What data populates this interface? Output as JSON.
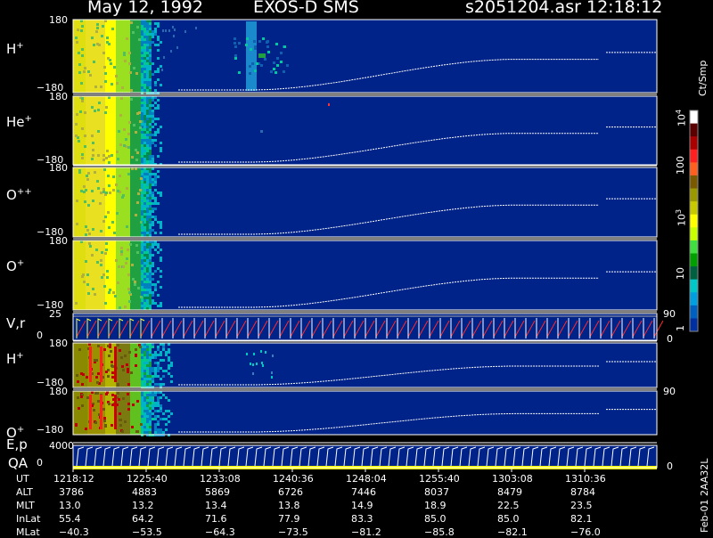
{
  "header": {
    "date": "May 12, 1992",
    "instrument": "EXOS-D SMS",
    "file": "s2051204.asr",
    "time": "12:18:12"
  },
  "panels": [
    {
      "name": "H",
      "sup": "+",
      "ymax": "180",
      "ymin": "−180"
    },
    {
      "name": "He",
      "sup": "+",
      "ymax": "180",
      "ymin": "−180"
    },
    {
      "name": "O",
      "sup": "++",
      "ymax": "180",
      "ymin": "−180"
    },
    {
      "name": "O",
      "sup": "+",
      "ymax": "180",
      "ymin": "−180"
    },
    {
      "name": "V,r",
      "sup": "",
      "ymax": "25",
      "ymin": "0",
      "rtop": "90",
      "rbot": "0"
    },
    {
      "name": "H",
      "sup": "+",
      "ymax": "180",
      "ymin": "−180"
    },
    {
      "name": "O",
      "sup": "+",
      "ymax": "180",
      "ymin": "−180",
      "rtop": "90"
    },
    {
      "name": "E,p",
      "sub": "QA",
      "ymax": "4000",
      "ymin": "0",
      "rbot": "0"
    }
  ],
  "colorbar": {
    "unit": "Ct/Smp",
    "ticks": [
      "10",
      "100",
      "10",
      "10",
      "1"
    ],
    "tick_sup": [
      "4",
      "",
      "3",
      "",
      ""
    ],
    "tick_labels": [
      "10⁴",
      "10³",
      "100",
      "10",
      "1"
    ],
    "colors": [
      "#ffffff",
      "#5a0000",
      "#aa0000",
      "#ff2020",
      "#ff6020",
      "#7a5a00",
      "#9a9a00",
      "#c8c800",
      "#ffff00",
      "#c8ff00",
      "#40e040",
      "#00a000",
      "#006040",
      "#00c8c8",
      "#00a0e0",
      "#0060c0",
      "#0030a0"
    ]
  },
  "chart_data": {
    "type": "heatmap",
    "x_axis_label": "UT",
    "ut_ticks": [
      "1218:12",
      "1225:40",
      "1233:08",
      "1240:36",
      "1248:04",
      "1255:40",
      "1303:08",
      "1310:36"
    ],
    "ephemeris": [
      {
        "label": "ALT",
        "values": [
          "3786",
          "4883",
          "5869",
          "6726",
          "7446",
          "8037",
          "8479",
          "8784"
        ]
      },
      {
        "label": "MLT",
        "values": [
          "13.0",
          "13.2",
          "13.4",
          "13.8",
          "14.9",
          "18.9",
          "22.5",
          "23.5"
        ]
      },
      {
        "label": "InLat",
        "values": [
          "55.4",
          "64.2",
          "71.6",
          "77.9",
          "83.3",
          "85.0",
          "85.0",
          "82.1"
        ]
      },
      {
        "label": "MLat",
        "values": [
          "−40.3",
          "−53.5",
          "−64.3",
          "−73.5",
          "−81.2",
          "−85.8",
          "−82.1",
          "−76.0"
        ]
      }
    ],
    "side_note": "Feb-01 2AA32L"
  }
}
